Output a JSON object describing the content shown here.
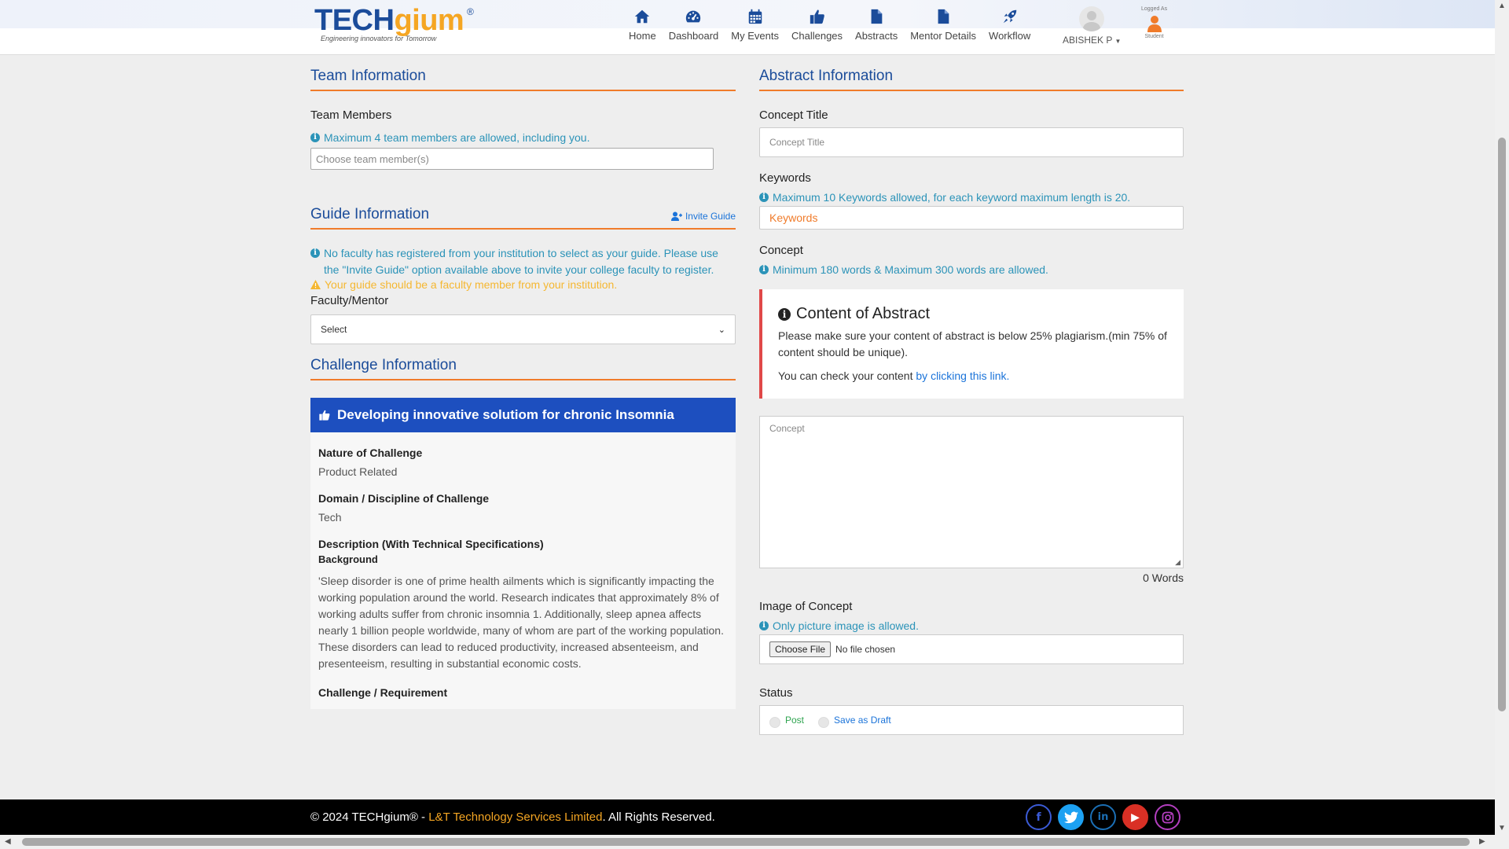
{
  "header": {
    "logo_text_a": "TECH",
    "logo_text_b": "gium",
    "logo_reg": "®",
    "logo_tagline": "Engineering innovators    for Tomorrow",
    "nav": [
      {
        "label": "Home",
        "icon": "home-icon"
      },
      {
        "label": "Dashboard",
        "icon": "dashboard-icon"
      },
      {
        "label": "My Events",
        "icon": "calendar-icon"
      },
      {
        "label": "Challenges",
        "icon": "thumbs-up-icon"
      },
      {
        "label": "Abstracts",
        "icon": "document-icon"
      },
      {
        "label": "Mentor Details",
        "icon": "document-icon"
      },
      {
        "label": "Workflow",
        "icon": "rocket-icon"
      }
    ],
    "user_name": "ABISHEK P",
    "logged_as": "Logged As",
    "role": "Student"
  },
  "team": {
    "title": "Team Information",
    "members_label": "Team Members",
    "members_info": "Maximum 4 team members are allowed, including you.",
    "members_placeholder": "Choose team member(s)"
  },
  "guide": {
    "title": "Guide Information",
    "invite_label": "Invite Guide",
    "info": "No faculty has registered from your institution to select as your guide. Please use the \"Invite Guide\" option available above to invite your college faculty to register.",
    "warning": "Your guide should be a faculty member from your institution.",
    "faculty_label": "Faculty/Mentor",
    "faculty_value": "Select"
  },
  "challenge": {
    "title": "Challenge Information",
    "name": "Developing innovative solutiom for chronic Insomnia",
    "nature_label": "Nature of Challenge",
    "nature_value": "Product Related",
    "domain_label": "Domain / Discipline of Challenge",
    "domain_value": "Tech",
    "description_label": "Description (With Technical Specifications)",
    "background_label": "Background",
    "background_text": "'Sleep disorder is one of prime health ailments which is significantly impacting the working population around the world. Research indicates that approximately 8% of working adults suffer from chronic insomnia 1. Additionally, sleep apnea affects nearly 1 billion people worldwide, many of whom are part of the working population. These disorders can lead to reduced productivity, increased absenteeism, and presenteeism, resulting in substantial economic costs.",
    "requirement_label": "Challenge / Requirement"
  },
  "abstract": {
    "title": "Abstract Information",
    "concept_title_label": "Concept Title",
    "concept_title_placeholder": "Concept Title",
    "keywords_label": "Keywords",
    "keywords_info": "Maximum 10 Keywords allowed, for each keyword maximum length is 20.",
    "keywords_placeholder": "Keywords",
    "concept_label": "Concept",
    "concept_info": "Minimum 180 words & Maximum 300 words are allowed.",
    "box_title": "Content of Abstract",
    "box_text": "Please make sure your content of abstract is below 25% plagiarism.(min 75% of content should be unique).",
    "box_check_text": "You can check your content ",
    "box_link": "by clicking this link.",
    "concept_placeholder": "Concept",
    "word_count": "0 Words",
    "image_label": "Image of Concept",
    "image_info": "Only picture image is allowed.",
    "choose_file": "Choose File",
    "no_file": "No file chosen",
    "status_label": "Status",
    "status_post": "Post",
    "status_draft": "Save as Draft"
  },
  "footer": {
    "copyright": "© 2024 TECHgium® - ",
    "company": "L&T Technology Services Limited",
    "rights": ". All Rights Reserved.",
    "socials": [
      "facebook-icon",
      "twitter-icon",
      "linkedin-icon",
      "youtube-icon",
      "instagram-icon"
    ]
  },
  "colors": {
    "brand_blue": "#1b4c9a",
    "accent_orange": "#f07b2a",
    "info_teal": "#2b93b8",
    "warning_yellow": "#f5b731",
    "challenge_blue": "#1d4fbf"
  }
}
